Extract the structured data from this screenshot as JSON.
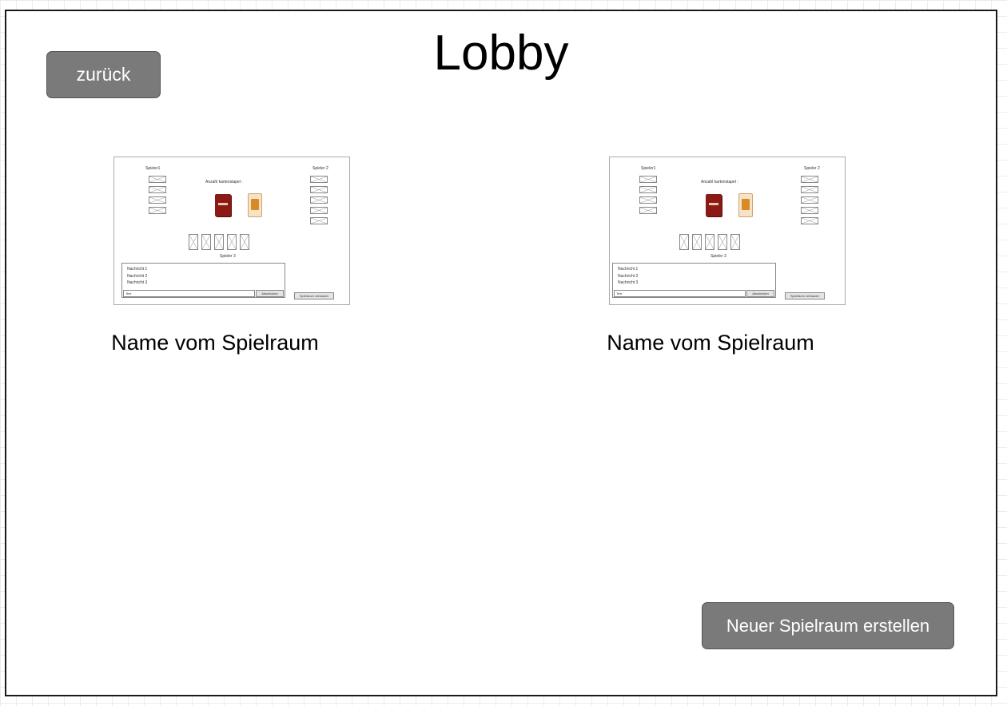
{
  "title": "Lobby",
  "back_button": {
    "label": "zurück"
  },
  "new_room_button": {
    "label": "Neuer Spielraum erstellen"
  },
  "rooms": [
    {
      "name": "Name vom Spielraum",
      "preview": {
        "player1": "Spieler1",
        "player2": "Spieler 2",
        "player3": "Spieler 3",
        "deck_count_label": "Anzahl kartenstapel :",
        "messages": [
          "Nachricht 1",
          "Nachricht 2",
          "Nachricht 3"
        ],
        "input_value": "Text",
        "send_button": "Abschicken",
        "leave_button": "Spielraum verlassen"
      }
    },
    {
      "name": "Name vom Spielraum",
      "preview": {
        "player1": "Spieler1",
        "player2": "Spieler 2",
        "player3": "Spieler 3",
        "deck_count_label": "Anzahl kartenstapel :",
        "messages": [
          "Nachricht 1",
          "Nachricht 2",
          "Nachricht 3"
        ],
        "input_value": "Text",
        "send_button": "Abschicken",
        "leave_button": "Spielraum verlassen"
      }
    }
  ]
}
